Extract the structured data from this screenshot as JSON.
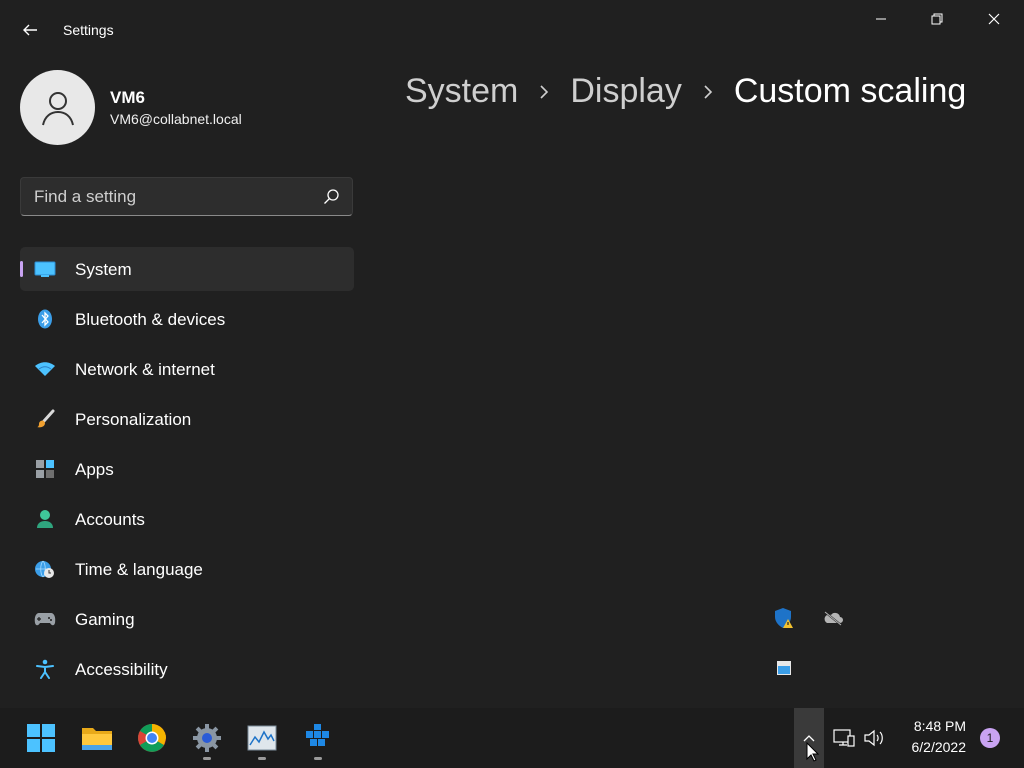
{
  "window": {
    "title": "Settings"
  },
  "profile": {
    "name": "VM6",
    "email": "VM6@collabnet.local"
  },
  "search": {
    "placeholder": "Find a setting",
    "value": ""
  },
  "nav": {
    "items": [
      {
        "label": "System",
        "icon": "system-icon",
        "selected": true
      },
      {
        "label": "Bluetooth & devices",
        "icon": "bluetooth-icon"
      },
      {
        "label": "Network & internet",
        "icon": "wifi-icon"
      },
      {
        "label": "Personalization",
        "icon": "brush-icon"
      },
      {
        "label": "Apps",
        "icon": "apps-icon"
      },
      {
        "label": "Accounts",
        "icon": "accounts-icon"
      },
      {
        "label": "Time & language",
        "icon": "globe-clock-icon"
      },
      {
        "label": "Gaming",
        "icon": "gamepad-icon"
      },
      {
        "label": "Accessibility",
        "icon": "accessibility-icon"
      }
    ]
  },
  "breadcrumb": {
    "items": [
      "System",
      "Display"
    ],
    "current": "Custom scaling"
  },
  "taskbar": {
    "apps": [
      "start-icon",
      "file-explorer-icon",
      "chrome-icon",
      "settings-icon",
      "resource-monitor-icon",
      "docker-icon"
    ],
    "clock": {
      "time": "8:48 PM",
      "date": "6/2/2022"
    },
    "notifications": "1"
  },
  "colors": {
    "background": "#202020",
    "accent": "#c9a3f2",
    "taskbar": "#1c1c1c"
  }
}
